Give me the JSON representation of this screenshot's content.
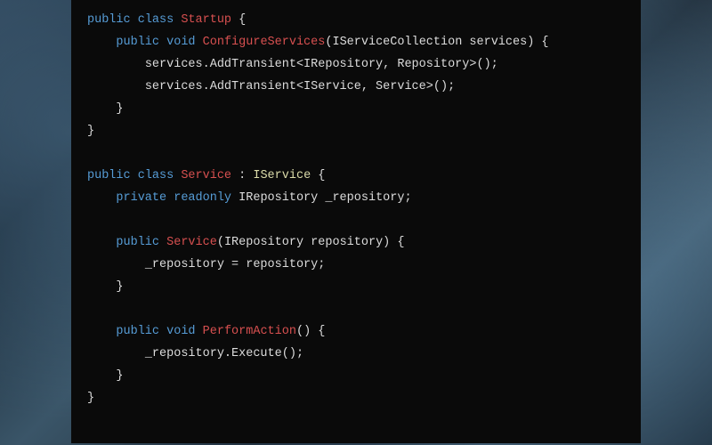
{
  "code": {
    "lines": [
      {
        "indent": 0,
        "tokens": [
          {
            "t": "public ",
            "c": "kw-mod"
          },
          {
            "t": "class ",
            "c": "kw-class"
          },
          {
            "t": "Startup",
            "c": "typename"
          },
          {
            "t": " {"
          }
        ]
      },
      {
        "indent": 1,
        "tokens": [
          {
            "t": "public ",
            "c": "kw-mod"
          },
          {
            "t": "void ",
            "c": "kw-void"
          },
          {
            "t": "ConfigureServices",
            "c": "typename"
          },
          {
            "t": "(IServiceCollection services) {"
          }
        ]
      },
      {
        "indent": 2,
        "tokens": [
          {
            "t": "services.AddTransient<IRepository, Repository>();"
          }
        ]
      },
      {
        "indent": 2,
        "tokens": [
          {
            "t": "services.AddTransient<IService, Service>();"
          }
        ]
      },
      {
        "indent": 1,
        "tokens": [
          {
            "t": "}"
          }
        ]
      },
      {
        "indent": 0,
        "tokens": [
          {
            "t": "}"
          }
        ]
      },
      {
        "indent": 0,
        "tokens": [
          {
            "t": ""
          }
        ]
      },
      {
        "indent": 0,
        "tokens": [
          {
            "t": "public ",
            "c": "kw-mod"
          },
          {
            "t": "class ",
            "c": "kw-class"
          },
          {
            "t": "Service",
            "c": "typename"
          },
          {
            "t": " : "
          },
          {
            "t": "IService",
            "c": "interface"
          },
          {
            "t": " {"
          }
        ]
      },
      {
        "indent": 1,
        "tokens": [
          {
            "t": "private ",
            "c": "kw-mod"
          },
          {
            "t": "readonly ",
            "c": "kw-mod"
          },
          {
            "t": "IRepository _repository;"
          }
        ]
      },
      {
        "indent": 0,
        "tokens": [
          {
            "t": ""
          }
        ]
      },
      {
        "indent": 1,
        "tokens": [
          {
            "t": "public ",
            "c": "kw-mod"
          },
          {
            "t": "Service",
            "c": "typename"
          },
          {
            "t": "(IRepository repository) {"
          }
        ]
      },
      {
        "indent": 2,
        "tokens": [
          {
            "t": "_repository = repository;"
          }
        ]
      },
      {
        "indent": 1,
        "tokens": [
          {
            "t": "}"
          }
        ]
      },
      {
        "indent": 0,
        "tokens": [
          {
            "t": ""
          }
        ]
      },
      {
        "indent": 1,
        "tokens": [
          {
            "t": "public ",
            "c": "kw-mod"
          },
          {
            "t": "void ",
            "c": "kw-void"
          },
          {
            "t": "PerformAction",
            "c": "typename"
          },
          {
            "t": "() {"
          }
        ]
      },
      {
        "indent": 2,
        "tokens": [
          {
            "t": "_repository.Execute();"
          }
        ]
      },
      {
        "indent": 1,
        "tokens": [
          {
            "t": "}"
          }
        ]
      },
      {
        "indent": 0,
        "tokens": [
          {
            "t": "}"
          }
        ]
      }
    ]
  },
  "indent_unit": "    ",
  "colors": {
    "background": "#0a0a0a",
    "default_text": "#dcdcdc",
    "keyword": "#569cd6",
    "typename": "#d85050",
    "interface": "#dcdcaa"
  }
}
